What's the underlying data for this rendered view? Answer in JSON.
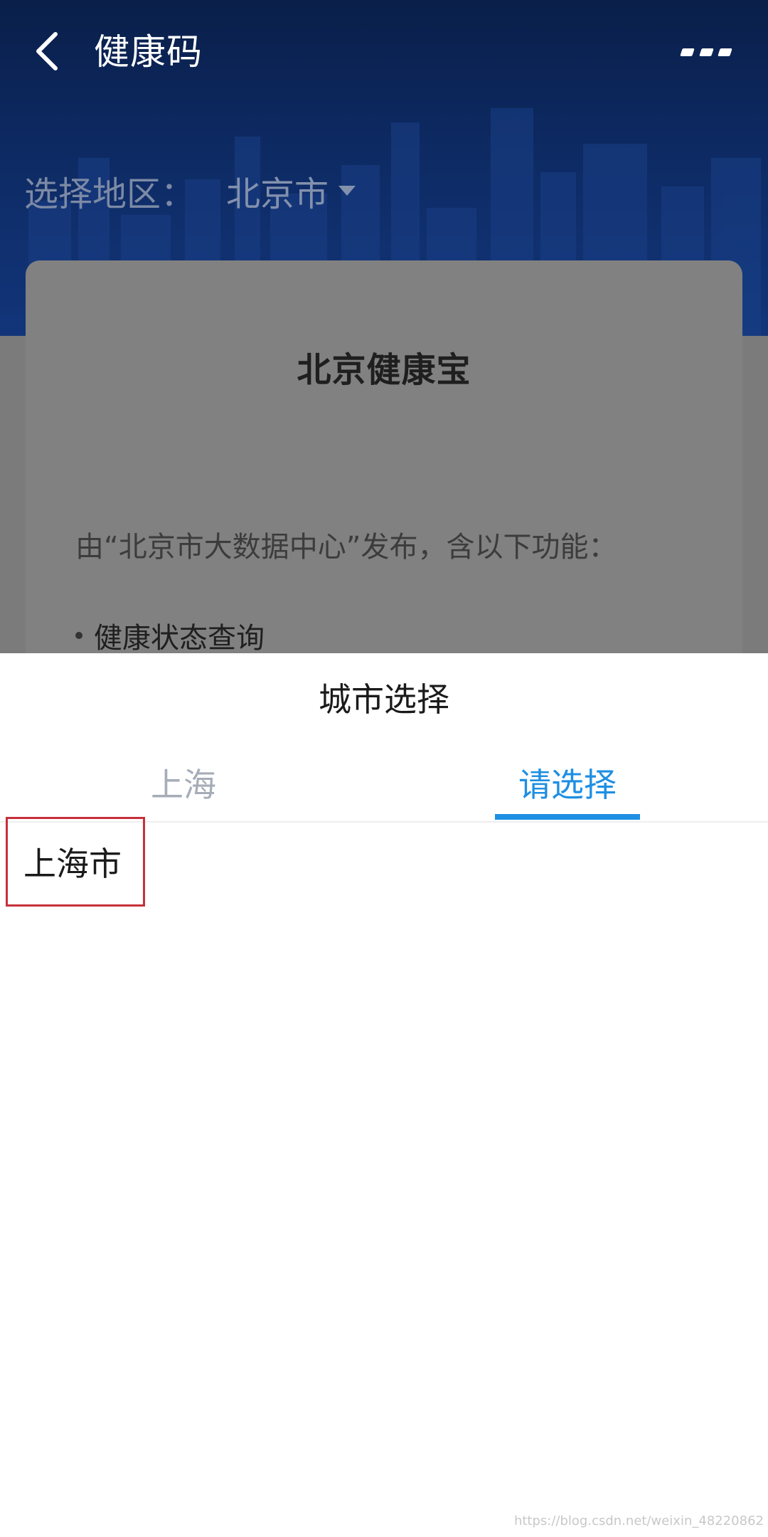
{
  "app": {
    "nav_title": "健康码",
    "back_icon": "chevron-left-icon",
    "more_icon": "more-icon"
  },
  "region": {
    "label": "选择地区：",
    "value": "北京市"
  },
  "card": {
    "title": "北京健康宝",
    "description": "由“北京市大数据中心”发布，含以下功能：",
    "bullet_1": "健康状态查询"
  },
  "sheet": {
    "title": "城市选择",
    "tabs": [
      {
        "label": "上海",
        "active": false
      },
      {
        "label": "请选择",
        "active": true
      }
    ],
    "options": [
      {
        "label": "上海市"
      }
    ]
  },
  "watermark": "https://blog.csdn.net/weixin_48220862",
  "colors": {
    "accent": "#1e8fe3",
    "highlight_border": "#c6303a",
    "hero_bg": "#0d2a63"
  }
}
